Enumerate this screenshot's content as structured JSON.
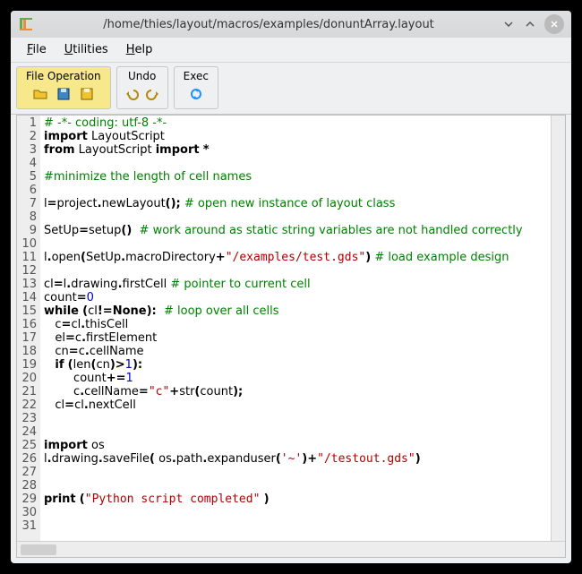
{
  "titlebar": {
    "title": "/home/thies/layout/macros/examples/donuntArray.layout"
  },
  "menubar": [
    {
      "mnemonic": "F",
      "rest": "ile"
    },
    {
      "mnemonic": "U",
      "rest": "tilities"
    },
    {
      "mnemonic": "H",
      "rest": "elp"
    }
  ],
  "toolbar": {
    "groups": [
      {
        "label": "File Operation",
        "icons": [
          "open-icon",
          "save-icon",
          "save-as-icon"
        ]
      },
      {
        "label": "Undo",
        "icons": [
          "undo-icon",
          "redo-icon"
        ]
      },
      {
        "label": "Exec",
        "icons": [
          "exec-icon"
        ]
      }
    ]
  },
  "editor": {
    "visible_lines": 31,
    "lines": [
      [
        {
          "t": "cm",
          "s": "# -*- coding: utf-8 -*-"
        }
      ],
      [
        {
          "t": "kw",
          "s": "import"
        },
        {
          "t": "",
          "s": " LayoutScript"
        }
      ],
      [
        {
          "t": "kw",
          "s": "from"
        },
        {
          "t": "",
          "s": " LayoutScript "
        },
        {
          "t": "kw",
          "s": "import"
        },
        {
          "t": "",
          "s": " "
        },
        {
          "t": "punct",
          "s": "*"
        }
      ],
      [],
      [
        {
          "t": "cm",
          "s": "#minimize the length of cell names"
        }
      ],
      [],
      [
        {
          "t": "",
          "s": "l"
        },
        {
          "t": "punct",
          "s": "="
        },
        {
          "t": "",
          "s": "project"
        },
        {
          "t": "punct",
          "s": "."
        },
        {
          "t": "",
          "s": "newLayout"
        },
        {
          "t": "punct",
          "s": "();"
        },
        {
          "t": "",
          "s": " "
        },
        {
          "t": "cm",
          "s": "# open new instance of layout class"
        }
      ],
      [],
      [
        {
          "t": "",
          "s": "SetUp"
        },
        {
          "t": "punct",
          "s": "="
        },
        {
          "t": "",
          "s": "setup"
        },
        {
          "t": "punct",
          "s": "()"
        },
        {
          "t": "",
          "s": "  "
        },
        {
          "t": "cm",
          "s": "# work around as static string variables are not handled correctly"
        }
      ],
      [],
      [
        {
          "t": "",
          "s": "l"
        },
        {
          "t": "punct",
          "s": "."
        },
        {
          "t": "",
          "s": "open"
        },
        {
          "t": "punct",
          "s": "("
        },
        {
          "t": "",
          "s": "SetUp"
        },
        {
          "t": "punct",
          "s": "."
        },
        {
          "t": "",
          "s": "macroDirectory"
        },
        {
          "t": "punct",
          "s": "+"
        },
        {
          "t": "str",
          "s": "\"/examples/test.gds\""
        },
        {
          "t": "punct",
          "s": ")"
        },
        {
          "t": "",
          "s": " "
        },
        {
          "t": "cm",
          "s": "# load example design"
        }
      ],
      [],
      [
        {
          "t": "",
          "s": "cl"
        },
        {
          "t": "punct",
          "s": "="
        },
        {
          "t": "",
          "s": "l"
        },
        {
          "t": "punct",
          "s": "."
        },
        {
          "t": "",
          "s": "drawing"
        },
        {
          "t": "punct",
          "s": "."
        },
        {
          "t": "",
          "s": "firstCell "
        },
        {
          "t": "cm",
          "s": "# pointer to current cell"
        }
      ],
      [
        {
          "t": "",
          "s": "count"
        },
        {
          "t": "punct",
          "s": "="
        },
        {
          "t": "num",
          "s": "0"
        }
      ],
      [
        {
          "t": "kw",
          "s": "while"
        },
        {
          "t": "",
          "s": " "
        },
        {
          "t": "punct",
          "s": "("
        },
        {
          "t": "",
          "s": "cl"
        },
        {
          "t": "punct",
          "s": "!="
        },
        {
          "t": "kw",
          "s": "None"
        },
        {
          "t": "punct",
          "s": "):"
        },
        {
          "t": "",
          "s": "  "
        },
        {
          "t": "cm",
          "s": "# loop over all cells"
        }
      ],
      [
        {
          "t": "",
          "s": "   c"
        },
        {
          "t": "punct",
          "s": "="
        },
        {
          "t": "",
          "s": "cl"
        },
        {
          "t": "punct",
          "s": "."
        },
        {
          "t": "",
          "s": "thisCell"
        }
      ],
      [
        {
          "t": "",
          "s": "   el"
        },
        {
          "t": "punct",
          "s": "="
        },
        {
          "t": "",
          "s": "c"
        },
        {
          "t": "punct",
          "s": "."
        },
        {
          "t": "",
          "s": "firstElement"
        }
      ],
      [
        {
          "t": "",
          "s": "   cn"
        },
        {
          "t": "punct",
          "s": "="
        },
        {
          "t": "",
          "s": "c"
        },
        {
          "t": "punct",
          "s": "."
        },
        {
          "t": "",
          "s": "cellName"
        }
      ],
      [
        {
          "t": "",
          "s": "   "
        },
        {
          "t": "kw",
          "s": "if"
        },
        {
          "t": "",
          "s": " "
        },
        {
          "t": "punct",
          "s": "("
        },
        {
          "t": "",
          "s": "len"
        },
        {
          "t": "punct",
          "s": "("
        },
        {
          "t": "",
          "s": "cn"
        },
        {
          "t": "punct",
          "s": ")>"
        },
        {
          "t": "num",
          "s": "1"
        },
        {
          "t": "punct",
          "s": "):"
        }
      ],
      [
        {
          "t": "",
          "s": "        count"
        },
        {
          "t": "punct",
          "s": "+="
        },
        {
          "t": "num",
          "s": "1"
        }
      ],
      [
        {
          "t": "",
          "s": "        c"
        },
        {
          "t": "punct",
          "s": "."
        },
        {
          "t": "",
          "s": "cellName"
        },
        {
          "t": "punct",
          "s": "="
        },
        {
          "t": "str",
          "s": "\"c\""
        },
        {
          "t": "punct",
          "s": "+"
        },
        {
          "t": "",
          "s": "str"
        },
        {
          "t": "punct",
          "s": "("
        },
        {
          "t": "",
          "s": "count"
        },
        {
          "t": "punct",
          "s": ");"
        }
      ],
      [
        {
          "t": "",
          "s": "   cl"
        },
        {
          "t": "punct",
          "s": "="
        },
        {
          "t": "",
          "s": "cl"
        },
        {
          "t": "punct",
          "s": "."
        },
        {
          "t": "",
          "s": "nextCell"
        }
      ],
      [],
      [],
      [
        {
          "t": "kw",
          "s": "import"
        },
        {
          "t": "",
          "s": " os"
        }
      ],
      [
        {
          "t": "",
          "s": "l"
        },
        {
          "t": "punct",
          "s": "."
        },
        {
          "t": "",
          "s": "drawing"
        },
        {
          "t": "punct",
          "s": "."
        },
        {
          "t": "",
          "s": "saveFile"
        },
        {
          "t": "punct",
          "s": "("
        },
        {
          "t": "",
          "s": " os"
        },
        {
          "t": "punct",
          "s": "."
        },
        {
          "t": "",
          "s": "path"
        },
        {
          "t": "punct",
          "s": "."
        },
        {
          "t": "",
          "s": "expanduser"
        },
        {
          "t": "punct",
          "s": "("
        },
        {
          "t": "str",
          "s": "'~'"
        },
        {
          "t": "punct",
          "s": ")+"
        },
        {
          "t": "str",
          "s": "\"/testout.gds\""
        },
        {
          "t": "punct",
          "s": ")"
        }
      ],
      [],
      [],
      [
        {
          "t": "kw",
          "s": "print"
        },
        {
          "t": "",
          "s": " "
        },
        {
          "t": "punct",
          "s": "("
        },
        {
          "t": "str",
          "s": "\"Python script completed\""
        },
        {
          "t": "",
          "s": " "
        },
        {
          "t": "punct",
          "s": ")"
        }
      ],
      [],
      []
    ]
  }
}
